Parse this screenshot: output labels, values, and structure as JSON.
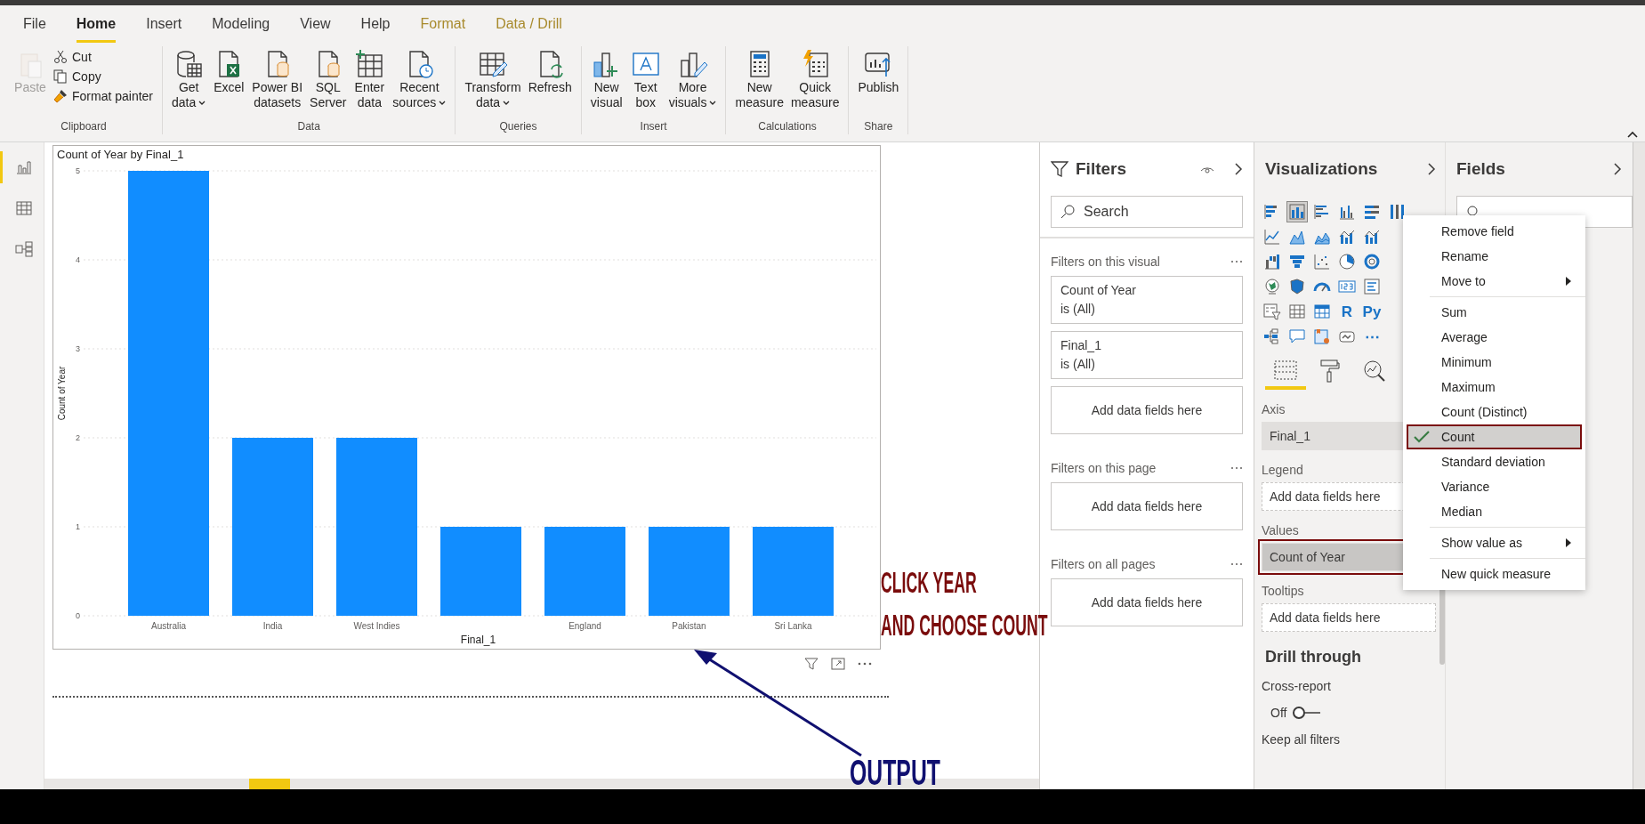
{
  "menu_tabs": [
    {
      "label": "File",
      "kind": "plain",
      "selected": false
    },
    {
      "label": "Home",
      "kind": "plain",
      "selected": true
    },
    {
      "label": "Insert",
      "kind": "plain",
      "selected": false
    },
    {
      "label": "Modeling",
      "kind": "plain",
      "selected": false
    },
    {
      "label": "View",
      "kind": "plain",
      "selected": false
    },
    {
      "label": "Help",
      "kind": "plain",
      "selected": false
    },
    {
      "label": "Format",
      "kind": "contextual",
      "selected": false
    },
    {
      "label": "Data / Drill",
      "kind": "contextual",
      "selected": false
    }
  ],
  "ribbon": [
    {
      "label": "Clipboard",
      "large": [
        {
          "kind": "paste",
          "lines": [
            "Paste"
          ],
          "disabled": true,
          "has_menu": false
        }
      ],
      "small": [
        {
          "kind": "cut",
          "lines": [
            "Cut"
          ],
          "disabled": false,
          "has_menu": false
        },
        {
          "kind": "copy",
          "lines": [
            "Copy"
          ],
          "disabled": false,
          "has_menu": false
        },
        {
          "kind": "format-painter",
          "lines": [
            "Format painter"
          ],
          "disabled": false,
          "has_menu": false
        }
      ]
    },
    {
      "label": "Data",
      "large": [
        {
          "kind": "get-data",
          "lines": [
            "Get",
            "data"
          ],
          "disabled": false,
          "has_menu": true
        },
        {
          "kind": "excel",
          "lines": [
            "Excel"
          ],
          "disabled": false,
          "has_menu": false
        },
        {
          "kind": "datasets",
          "lines": [
            "Power BI",
            "datasets"
          ],
          "disabled": false,
          "has_menu": false
        },
        {
          "kind": "sql",
          "lines": [
            "SQL",
            "Server"
          ],
          "disabled": false,
          "has_menu": false
        },
        {
          "kind": "enter-data",
          "lines": [
            "Enter",
            "data"
          ],
          "disabled": false,
          "has_menu": false
        },
        {
          "kind": "recent",
          "lines": [
            "Recent",
            "sources"
          ],
          "disabled": false,
          "has_menu": true
        }
      ]
    },
    {
      "label": "Queries",
      "large": [
        {
          "kind": "transform",
          "lines": [
            "Transform",
            "data"
          ],
          "disabled": false,
          "has_menu": true
        },
        {
          "kind": "refresh",
          "lines": [
            "Refresh"
          ],
          "disabled": false,
          "has_menu": false
        }
      ]
    },
    {
      "label": "Insert",
      "large": [
        {
          "kind": "new-visual",
          "lines": [
            "New",
            "visual"
          ],
          "disabled": false,
          "has_menu": false
        },
        {
          "kind": "text-box",
          "lines": [
            "Text",
            "box"
          ],
          "disabled": false,
          "has_menu": false
        },
        {
          "kind": "more-visuals",
          "lines": [
            "More",
            "visuals"
          ],
          "disabled": false,
          "has_menu": true
        }
      ]
    },
    {
      "label": "Calculations",
      "large": [
        {
          "kind": "new-measure",
          "lines": [
            "New",
            "measure"
          ],
          "disabled": false,
          "has_menu": false
        },
        {
          "kind": "quick-measure",
          "lines": [
            "Quick",
            "measure"
          ],
          "disabled": false,
          "has_menu": false
        }
      ]
    },
    {
      "label": "Share",
      "large": [
        {
          "kind": "publish",
          "lines": [
            "Publish"
          ],
          "disabled": false,
          "has_menu": false
        }
      ]
    }
  ],
  "views": [
    {
      "kind": "report",
      "selected": true
    },
    {
      "kind": "data",
      "selected": false
    },
    {
      "kind": "model",
      "selected": false
    }
  ],
  "visual": {
    "chart_data": {
      "type": "bar",
      "title": "Count of Year by Final_1",
      "xlabel": "Final_1",
      "ylabel": "Count of Year",
      "categories": [
        "Australia",
        "India",
        "West Indies",
        null,
        "England",
        "Pakistan",
        "Sri Lanka"
      ],
      "values": [
        5,
        2,
        2,
        1,
        1,
        1,
        1
      ],
      "ylim": [
        0,
        5
      ],
      "yticks": [
        0,
        1,
        2,
        3,
        4,
        5
      ],
      "grid": true
    }
  },
  "annotations": {
    "callout": [
      "CLICK YEAR",
      "AND CHOOSE COUNT"
    ],
    "output": "OUTPUT"
  },
  "filters": {
    "title": "Filters",
    "search": {
      "placeholder": "Search"
    },
    "sections": [
      {
        "title": "Filters on this visual",
        "cards": [
          {
            "kind": "filter",
            "name": "Count of Year",
            "condition": "is (All)"
          },
          {
            "kind": "filter",
            "name": "Final_1",
            "condition": "is (All)"
          },
          {
            "kind": "drop",
            "name": "Add data fields here"
          }
        ]
      },
      {
        "title": "Filters on this page",
        "cards": [
          {
            "kind": "drop",
            "name": "Add data fields here"
          }
        ]
      },
      {
        "title": "Filters on all pages",
        "cards": [
          {
            "kind": "drop",
            "name": "Add data fields here"
          }
        ]
      }
    ]
  },
  "visualizations": {
    "title": "Visualizations",
    "types": [
      [
        {
          "kind": "stacked-bar",
          "selected": false
        },
        {
          "kind": "stacked-column",
          "selected": true
        },
        {
          "kind": "clustered-bar",
          "selected": false
        },
        {
          "kind": "clustered-column",
          "selected": false
        },
        {
          "kind": "full-bar",
          "selected": false
        },
        {
          "kind": "full-column",
          "selected": false
        }
      ],
      [
        {
          "kind": "line",
          "selected": false
        },
        {
          "kind": "area",
          "selected": false
        },
        {
          "kind": "stacked-area",
          "selected": false
        },
        {
          "kind": "line-column",
          "selected": false
        },
        {
          "kind": "line-column",
          "selected": false
        }
      ],
      [
        {
          "kind": "waterfall",
          "selected": false
        },
        {
          "kind": "funnel",
          "selected": false
        },
        {
          "kind": "scatter",
          "selected": false
        },
        {
          "kind": "pie",
          "selected": false
        },
        {
          "kind": "donut",
          "selected": false
        }
      ],
      [
        {
          "kind": "map",
          "selected": false
        },
        {
          "kind": "filled-map",
          "selected": false
        },
        {
          "kind": "gauge",
          "selected": false
        },
        {
          "kind": "card",
          "selected": false
        },
        {
          "kind": "multirow",
          "selected": false
        }
      ],
      [
        {
          "kind": "slicer",
          "selected": false
        },
        {
          "kind": "table",
          "selected": false
        },
        {
          "kind": "matrix",
          "selected": false
        },
        {
          "kind": "text",
          "label": "R",
          "selected": false
        },
        {
          "kind": "text",
          "label": "Py",
          "selected": false
        }
      ],
      [
        {
          "kind": "tree",
          "selected": false
        },
        {
          "kind": "qa",
          "selected": false
        },
        {
          "kind": "influencers",
          "selected": false
        },
        {
          "kind": "paginated",
          "selected": false
        },
        {
          "kind": "text",
          "label": "⋯",
          "selected": false
        }
      ]
    ],
    "panes": [
      {
        "kind": "fields",
        "selected": true
      },
      {
        "kind": "format",
        "selected": false
      },
      {
        "kind": "analytics",
        "selected": false
      }
    ],
    "wells": [
      {
        "label": "Axis",
        "field": "Final_1",
        "kind": "field",
        "highlighted": false
      },
      {
        "label": "Legend",
        "field": "Add data fields here",
        "kind": "drop",
        "highlighted": false
      },
      {
        "label": "Values",
        "field": "Count of Year",
        "kind": "field",
        "highlighted": true
      },
      {
        "label": "Tooltips",
        "field": "Add data fields here",
        "kind": "drop",
        "highlighted": false
      }
    ],
    "drill": {
      "title": "Drill through",
      "toggle_label": "Cross-report",
      "state": "Off",
      "on": false,
      "keep": "Keep all filters"
    }
  },
  "fields": {
    "title": "Fields"
  },
  "context_menu": [
    [
      {
        "label": "Remove field",
        "checked": false,
        "submenu": false,
        "selected": false
      },
      {
        "label": "Rename",
        "checked": false,
        "submenu": false,
        "selected": false
      },
      {
        "label": "Move to",
        "checked": false,
        "submenu": true,
        "selected": false
      }
    ],
    [
      {
        "label": "Sum",
        "checked": false,
        "submenu": false,
        "selected": false
      },
      {
        "label": "Average",
        "checked": false,
        "submenu": false,
        "selected": false
      },
      {
        "label": "Minimum",
        "checked": false,
        "submenu": false,
        "selected": false
      },
      {
        "label": "Maximum",
        "checked": false,
        "submenu": false,
        "selected": false
      },
      {
        "label": "Count (Distinct)",
        "checked": false,
        "submenu": false,
        "selected": false
      },
      {
        "label": "Count",
        "checked": true,
        "submenu": false,
        "selected": true
      },
      {
        "label": "Standard deviation",
        "checked": false,
        "submenu": false,
        "selected": false
      },
      {
        "label": "Variance",
        "checked": false,
        "submenu": false,
        "selected": false
      },
      {
        "label": "Median",
        "checked": false,
        "submenu": false,
        "selected": false
      }
    ],
    [
      {
        "label": "Show value as",
        "checked": false,
        "submenu": true,
        "selected": false
      }
    ],
    [
      {
        "label": "New quick measure",
        "checked": false,
        "submenu": false,
        "selected": false
      }
    ]
  ]
}
